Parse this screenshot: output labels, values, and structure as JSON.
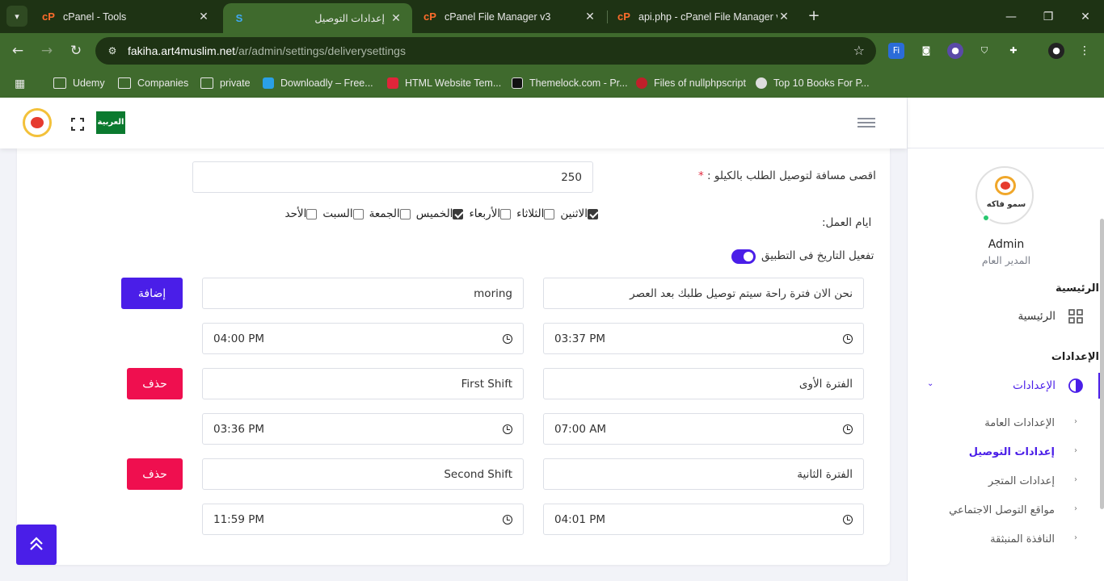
{
  "browser": {
    "tab_search_icon": "chevron-down-icon",
    "tabs": [
      {
        "label": "cPanel - Tools",
        "favicon": "cP"
      },
      {
        "label": "إعدادات التوصيل",
        "favicon": "S"
      },
      {
        "label": "cPanel File Manager v3",
        "favicon": "cP"
      },
      {
        "label": "api.php - cPanel File Manager v",
        "favicon": "cP"
      }
    ],
    "url_host": "fakiha.art4muslim.net",
    "url_path": "/ar/admin/settings/deliverysettings",
    "bookmarks": [
      {
        "label": "Udemy"
      },
      {
        "label": "Companies"
      },
      {
        "label": "private"
      },
      {
        "label": "Downloadly – Free..."
      },
      {
        "label": "HTML Website Tem..."
      },
      {
        "label": "Themelock.com - Pr..."
      },
      {
        "label": "Files of nullphpscript"
      },
      {
        "label": "Top 10 Books For P..."
      }
    ]
  },
  "header": {
    "language_flag": "العربية"
  },
  "form": {
    "max_distance_label": "اقصى مسافة لتوصيل الطلب بالكيلو :",
    "required_mark": "*",
    "max_distance_value": "250",
    "work_days_label": "ايام العمل:",
    "days": [
      {
        "label": "الاثنين",
        "checked": true
      },
      {
        "label": "الثلاثاء",
        "checked": false
      },
      {
        "label": "الأربعاء",
        "checked": false
      },
      {
        "label": "الخميس",
        "checked": true
      },
      {
        "label": "الجمعة",
        "checked": false
      },
      {
        "label": "السبت",
        "checked": false
      },
      {
        "label": "الأحد",
        "checked": false
      }
    ],
    "date_toggle_label": "تفعيل التاريخ فى التطبيق",
    "date_toggle_on": true,
    "shifts": [
      {
        "name_ar": "نحن الان فترة راحة سيتم توصيل طلبك بعد العصر",
        "name_en": "moring",
        "time_from": "03:37 PM",
        "time_to": "04:00 PM",
        "action": "إضافة"
      },
      {
        "name_ar": "الفترة الأوى",
        "name_en": "First Shift",
        "time_from": "07:00 AM",
        "time_to": "03:36 PM",
        "action": "حذف"
      },
      {
        "name_ar": "الفترة الثانية",
        "name_en": "Second Shift",
        "time_from": "04:01 PM",
        "time_to": "11:59 PM",
        "action": "حذف"
      }
    ]
  },
  "sidebar": {
    "user_name": "Admin",
    "user_role": "المدير العام",
    "logo_text": "سمو فاكه",
    "section_home": "الرئيسية",
    "item_home": "الرئيسية",
    "section_settings": "الإعدادات",
    "item_settings": "الإعدادات",
    "sub_items": [
      {
        "label": "الإعدادات العامة",
        "active": false
      },
      {
        "label": "إعدادات التوصيل",
        "active": true
      },
      {
        "label": "إعدادات المتجر",
        "active": false
      },
      {
        "label": "مواقع التوصل الاجتماعي",
        "active": false
      },
      {
        "label": "النافذة المنبثقة",
        "active": false
      }
    ]
  },
  "colors": {
    "primary": "#4a1ee8",
    "danger": "#ef0f4f",
    "chrome": "#3f6a2d"
  }
}
